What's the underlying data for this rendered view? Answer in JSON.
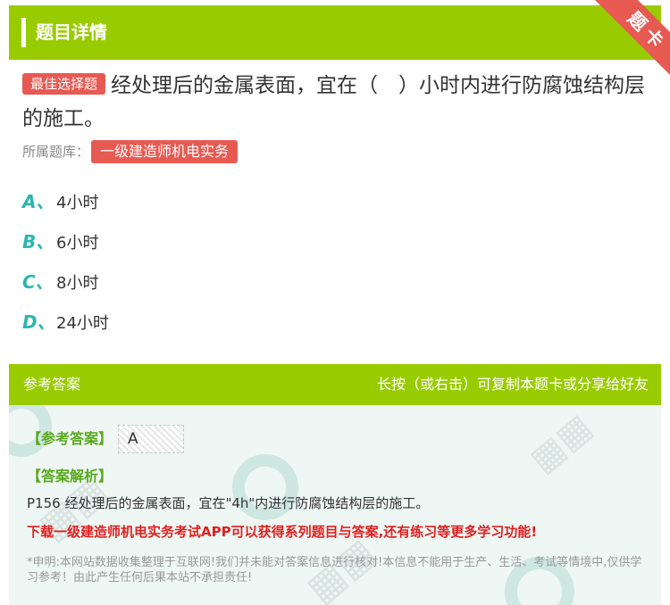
{
  "header": {
    "title": "题目详情",
    "corner_badge": "题卡"
  },
  "question": {
    "type_badge": "最佳选择题",
    "text": "经处理后的金属表面，宜在（　）小时内进行防腐蚀结构层的施工。",
    "bank_label": "所属题库：",
    "bank_name": "一级建造师机电实务"
  },
  "options": [
    {
      "letter": "A、",
      "text": "4小时"
    },
    {
      "letter": "B、",
      "text": "6小时"
    },
    {
      "letter": "C、",
      "text": "8小时"
    },
    {
      "letter": "D、",
      "text": "24小时"
    }
  ],
  "answer_section": {
    "title": "参考答案",
    "hint": "长按（或右击）可复制本题卡或分享给好友",
    "answer_label": "【参考答案】",
    "answer_value": "A",
    "explanation_label": "【答案解析】",
    "explanation_text": "P156 经处理后的金属表面，宜在\"4h\"内进行防腐蚀结构层的施工。",
    "promo_text": "下载一级建造师机电实务考试APP可以获得系列题目与答案,还有练习等更多学习功能!",
    "disclaimer": "*申明:本网站数据收集整理于互联网!我们并未能对答案信息进行核对!本信息不能用于生产、生活、考试等情境中,仅供学习参考！由此产生任何后果本站不承担责任!"
  },
  "colors": {
    "brand_green": "#99cc00",
    "badge_red": "#e75a52",
    "option_teal": "#2bb7b0",
    "answer_green": "#5aaa1e",
    "promo_red": "#e02020"
  }
}
